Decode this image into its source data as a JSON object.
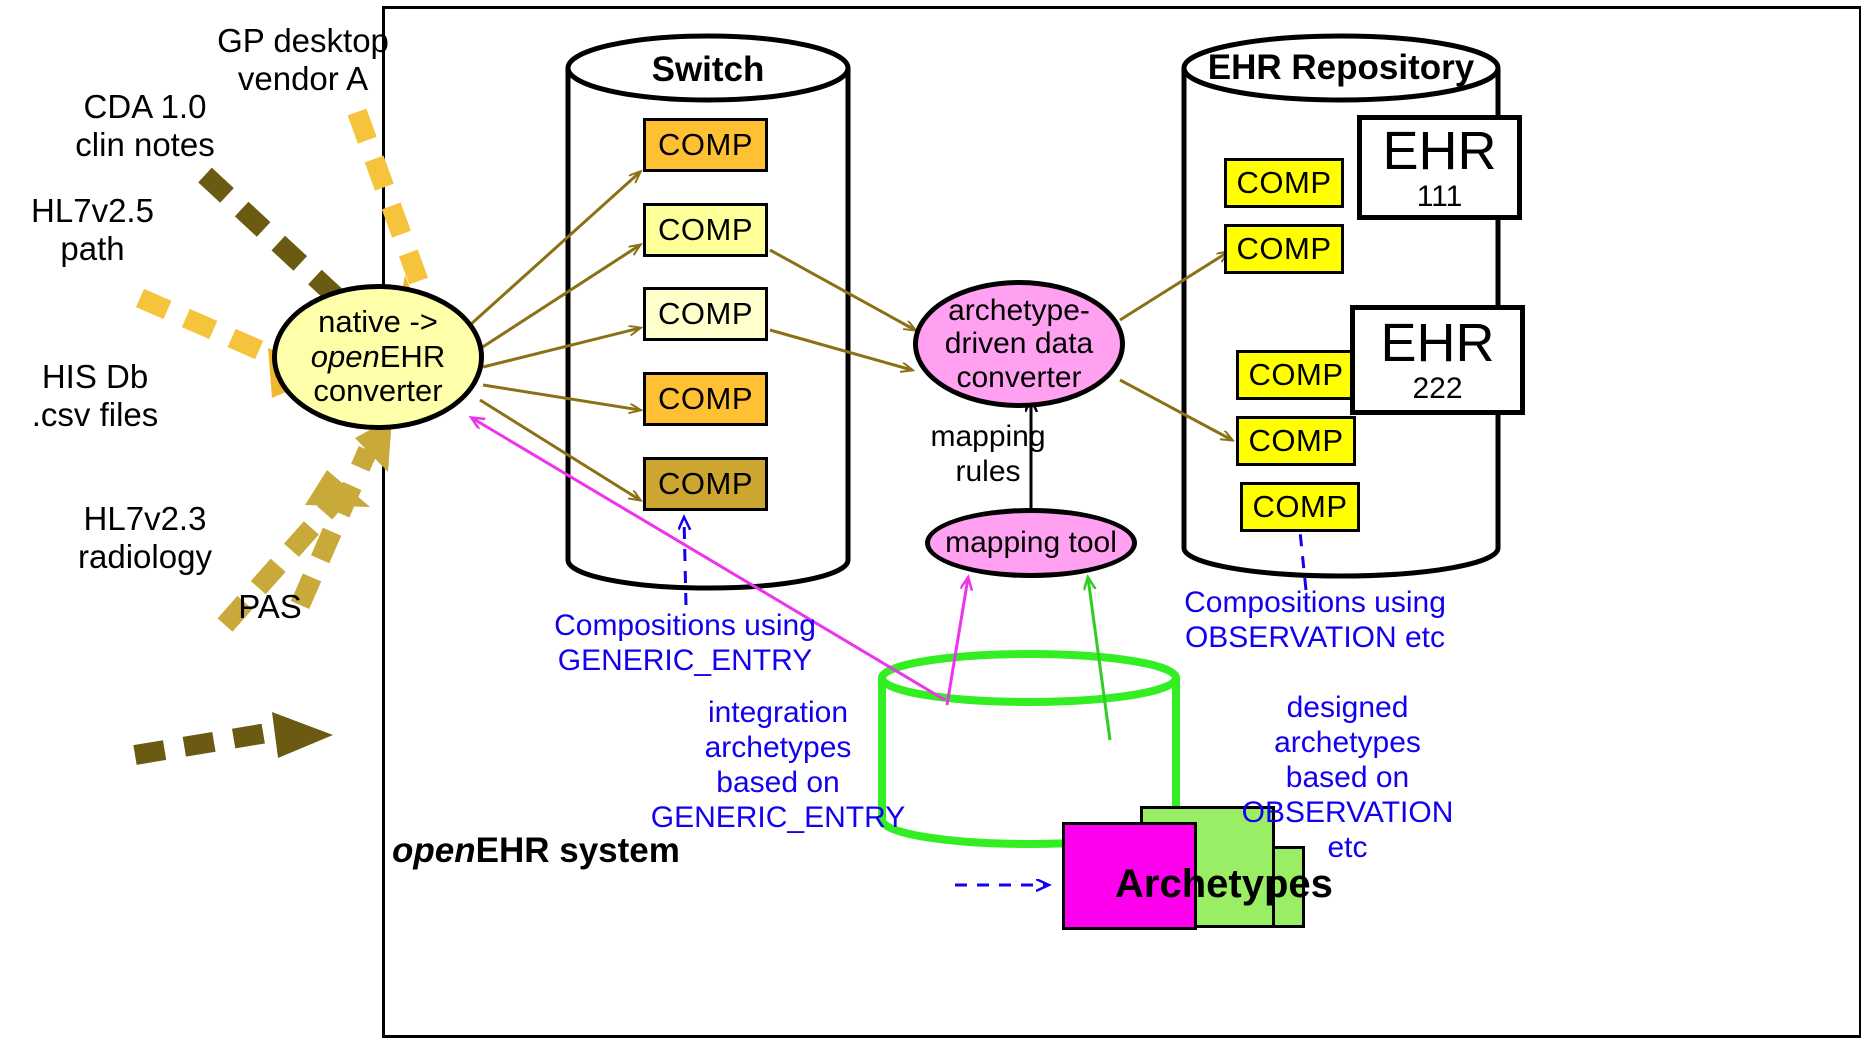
{
  "diagram": {
    "title": "openEHR system integration diagram",
    "boundary_label_prefix": "open",
    "boundary_label_suffix": "EHR system"
  },
  "colors": {
    "comp_orange": "#FFC033",
    "comp_light_yellow": "#FFFF99",
    "comp_pale_yellow": "#FFFFCC",
    "comp_tan": "#CCA62E",
    "comp_yellow": "#FFFF00",
    "ellipse_yellow": "#FFFFAA",
    "ellipse_pink": "#FFA0F0",
    "archetype_green": "#33EE22",
    "archetype_magenta": "#FF00EE",
    "archetype_lightgreen": "#99EE66",
    "note_blue": "#1200EE",
    "arrow_olive": "#8B7015",
    "arrow_magenta": "#EE33EE",
    "dash_gold": "#F5C43C",
    "dash_dark_olive": "#6B5B12",
    "dash_olive": "#C8A93A",
    "black": "#000000"
  },
  "sources": [
    {
      "name": "gp-desktop-vendor-a",
      "text": "GP desktop\nvendor A"
    },
    {
      "name": "cda-clin-notes",
      "text": "CDA 1.0\nclin notes"
    },
    {
      "name": "hl7v25-path",
      "text": "HL7v2.5\npath"
    },
    {
      "name": "his-db-csv",
      "text": "HIS Db\n.csv files"
    },
    {
      "name": "hl7v23-radiology",
      "text": "HL7v2.3\nradiology"
    },
    {
      "name": "pas",
      "text": "PAS"
    }
  ],
  "converter": {
    "line1": "native ->",
    "line2_italic": "open",
    "line2_rest": "EHR",
    "line3": "converter"
  },
  "switch": {
    "title": "Switch",
    "comps": [
      {
        "label": "COMP",
        "fill": "#FFC033"
      },
      {
        "label": "COMP",
        "fill": "#FFFF99"
      },
      {
        "label": "COMP",
        "fill": "#FFFFCC"
      },
      {
        "label": "COMP",
        "fill": "#FFC033"
      },
      {
        "label": "COMP",
        "fill": "#CCA62E"
      }
    ]
  },
  "archetype_converter": {
    "line1": "archetype-",
    "line2": "driven data",
    "line3": "converter"
  },
  "mapping_rules_label": "mapping\nrules",
  "mapping_tool": {
    "label": "mapping tool"
  },
  "ehr_repository": {
    "title": "EHR Repository",
    "comps": [
      {
        "label": "COMP"
      },
      {
        "label": "COMP"
      },
      {
        "label": "COMP"
      },
      {
        "label": "COMP"
      },
      {
        "label": "COMP"
      }
    ],
    "ehrs": [
      {
        "big": "EHR",
        "small": "111"
      },
      {
        "big": "EHR",
        "small": "222"
      }
    ]
  },
  "archetypes": {
    "label": "Archetypes"
  },
  "notes": [
    {
      "name": "note-compositions-generic-entry",
      "text": "Compositions using\nGENERIC_ENTRY"
    },
    {
      "name": "note-compositions-observation",
      "text": "Compositions using\nOBSERVATION etc"
    },
    {
      "name": "note-integration-archetypes",
      "text": "integration\narchetypes\nbased on\nGENERIC_ENTRY"
    },
    {
      "name": "note-designed-archetypes",
      "text": "designed\narchetypes\nbased on\nOBSERVATION\netc"
    }
  ]
}
